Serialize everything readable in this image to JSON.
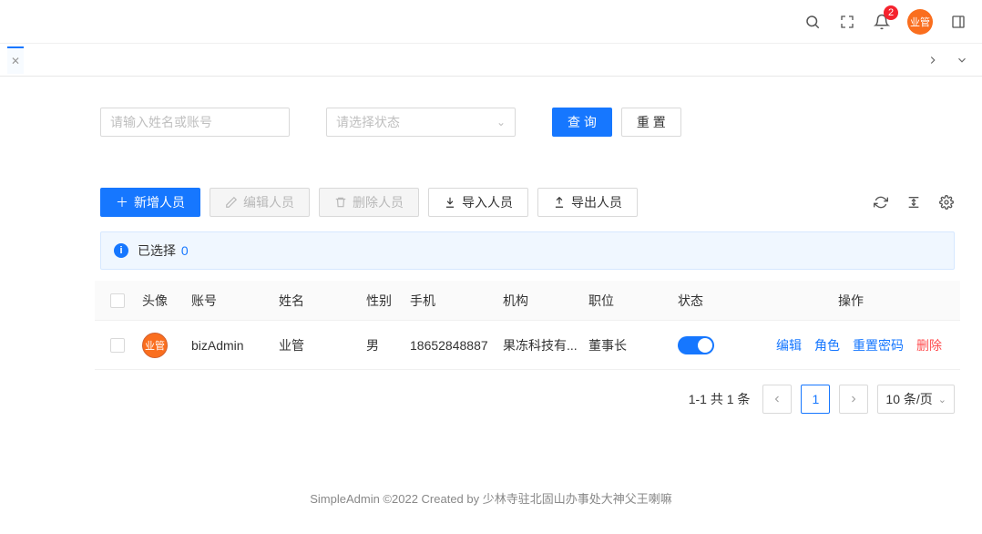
{
  "header": {
    "badge_count": "2",
    "avatar_text": "业管"
  },
  "search": {
    "name_placeholder": "请输入姓名或账号",
    "status_placeholder": "请选择状态",
    "query_btn": "查 询",
    "reset_btn": "重 置"
  },
  "toolbar": {
    "add_btn": "新增人员",
    "edit_btn": "编辑人员",
    "delete_btn": "删除人员",
    "import_btn": "导入人员",
    "export_btn": "导出人员"
  },
  "alert": {
    "label": "已选择",
    "count": "0"
  },
  "columns": {
    "avatar": "头像",
    "account": "账号",
    "name": "姓名",
    "gender": "性别",
    "phone": "手机",
    "org": "机构",
    "position": "职位",
    "status": "状态",
    "actions": "操作"
  },
  "row": {
    "avatar_text": "业管",
    "account": "bizAdmin",
    "name": "业管",
    "gender": "男",
    "phone": "18652848887",
    "org": "果冻科技有...",
    "position": "董事长"
  },
  "actions": {
    "edit": "编辑",
    "role": "角色",
    "reset_pwd": "重置密码",
    "delete": "删除"
  },
  "pagination": {
    "info": "1-1 共 1 条",
    "current": "1",
    "size": "10 条/页"
  },
  "footer": "SimpleAdmin ©2022 Created by 少林寺驻北固山办事处大神父王喇嘛"
}
